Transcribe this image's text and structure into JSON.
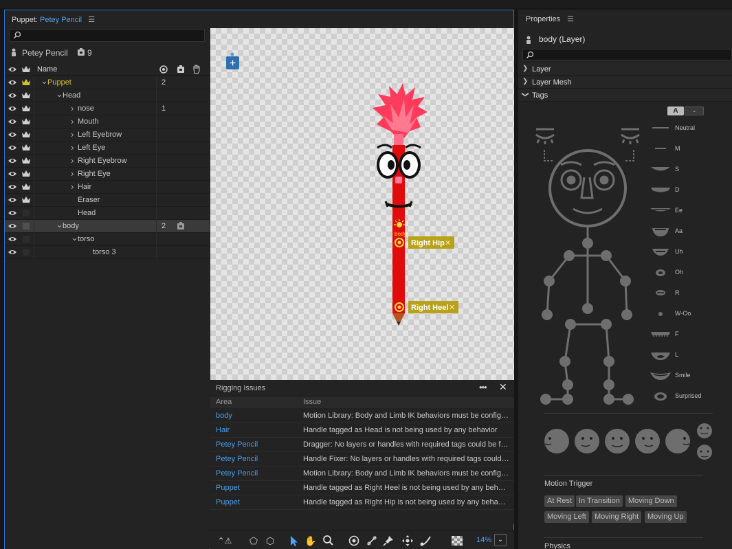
{
  "puppet_panel": {
    "title_prefix": "Puppet:",
    "puppet_name": "Petey Pencil",
    "menu_icon": "hamburger-icon"
  },
  "layers": {
    "puppet_name": "Petey Pencil",
    "track_count": "9",
    "column_name": "Name",
    "rows": [
      {
        "label": "Puppet",
        "count": "2"
      },
      {
        "label": "Head",
        "count": ""
      },
      {
        "label": "nose",
        "count": "1"
      },
      {
        "label": "Mouth",
        "count": ""
      },
      {
        "label": "Left Eyebrow",
        "count": ""
      },
      {
        "label": "Left Eye",
        "count": ""
      },
      {
        "label": "Right Eyebrow",
        "count": ""
      },
      {
        "label": "Right Eye",
        "count": ""
      },
      {
        "label": "Hair",
        "count": ""
      },
      {
        "label": "Eraser",
        "count": ""
      },
      {
        "label": "Head",
        "count": ""
      },
      {
        "label": "body",
        "count": "2"
      },
      {
        "label": "torso",
        "count": ""
      },
      {
        "label": "torso 3",
        "count": ""
      }
    ]
  },
  "canvas": {
    "handle_labels": {
      "hip": "Right Hip",
      "heel": "Right Heel",
      "origin": "body"
    },
    "colors": {
      "pencil": "#e00b0b",
      "hair": "#ff3b5c",
      "handle_tag": "#b8a21b"
    }
  },
  "rigging_issues": {
    "title": "Rigging Issues",
    "col_area": "Area",
    "col_issue": "Issue",
    "rows": [
      {
        "area": "body",
        "issue": "Motion Library: Body and Limb IK behaviors must be configured"
      },
      {
        "area": "Hair",
        "issue": "Handle tagged as Head is not being used by any behavior"
      },
      {
        "area": "Petey Pencil",
        "issue": "Dragger: No layers or handles with required tags could be found"
      },
      {
        "area": "Petey Pencil",
        "issue": "Handle Fixer: No layers or handles with required tags could be found"
      },
      {
        "area": "Petey Pencil",
        "issue": "Motion Library: Body and Limb IK behaviors must be configured"
      },
      {
        "area": "Puppet",
        "issue": "Handle tagged as Right Heel is not being used by any behavior"
      },
      {
        "area": "Puppet",
        "issue": "Handle tagged as Right Hip is not being used by any behavior"
      }
    ]
  },
  "toolbar": {
    "zoom": "14%"
  },
  "properties": {
    "title": "Properties",
    "layer_title": "body (Layer)",
    "sections": [
      "Layer",
      "Layer Mesh",
      "Tags"
    ],
    "tag_mode_a": "A",
    "mouth_tags": [
      "Neutral",
      "M",
      "S",
      "D",
      "Ee",
      "Aa",
      "Uh",
      "Oh",
      "R",
      "W-Oo",
      "F",
      "L",
      "Smile",
      "Surprised"
    ],
    "motion_trigger_title": "Motion Trigger",
    "motion_triggers": [
      "At Rest",
      "In Transition",
      "Moving Down",
      "Moving Left",
      "Moving Right",
      "Moving Up"
    ],
    "physics_title": "Physics"
  }
}
